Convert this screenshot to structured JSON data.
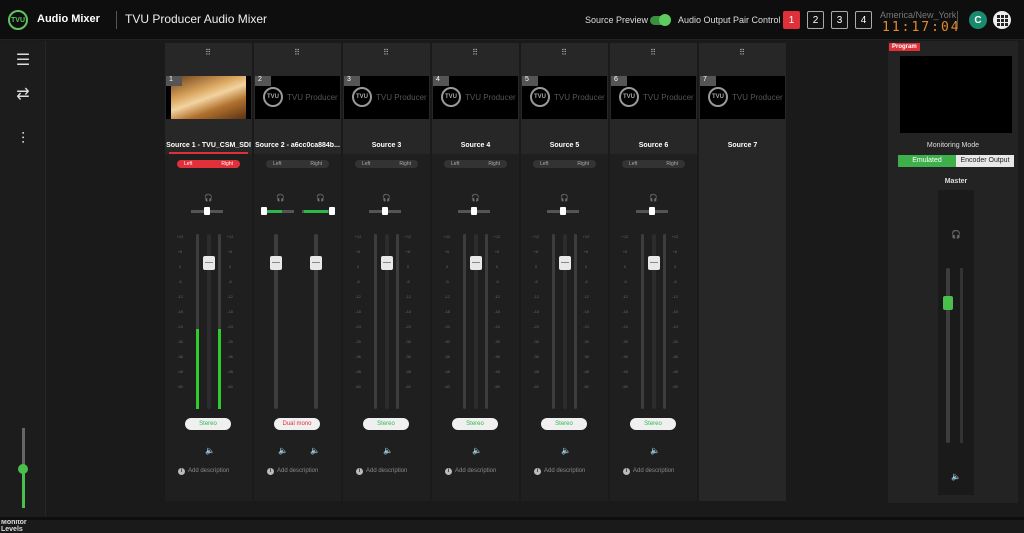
{
  "app": {
    "name": "Audio Mixer",
    "title": "TVU Producer Audio Mixer",
    "logo_text": "TVU"
  },
  "header": {
    "source_preview_label": "Source Preview",
    "source_preview_on": true,
    "audio_output_label": "Audio Output Pair Control",
    "pairs": [
      "1",
      "2",
      "3",
      "4"
    ],
    "active_pair": "1",
    "timezone": "America/New_York",
    "clock": "11:17:04",
    "avatar_initial": "C"
  },
  "left_nav": {
    "monitor_label": "Monitor Levels",
    "monitor_level": 0.5
  },
  "strips": [
    {
      "num": "1",
      "name": "Source 1 - TVU_CSM_SDI",
      "left": "Left",
      "right": "Right",
      "mode": "Stereo",
      "has_video": true,
      "active": true,
      "desc": "Add description"
    },
    {
      "num": "2",
      "name": "Source 2 - a6cc0ca884b...",
      "left": "Left",
      "right": "Right",
      "mode": "Dual mono",
      "has_video": false,
      "active": false,
      "desc": "Add description"
    },
    {
      "num": "3",
      "name": "Source 3",
      "left": "Left",
      "right": "Right",
      "mode": "Stereo",
      "has_video": false,
      "active": false,
      "desc": "Add description"
    },
    {
      "num": "4",
      "name": "Source 4",
      "left": "Left",
      "right": "Right",
      "mode": "Stereo",
      "has_video": false,
      "active": false,
      "desc": "Add description"
    },
    {
      "num": "5",
      "name": "Source 5",
      "left": "Left",
      "right": "Right",
      "mode": "Stereo",
      "has_video": false,
      "active": false,
      "desc": "Add description"
    },
    {
      "num": "6",
      "name": "Source 6",
      "left": "Left",
      "right": "Right",
      "mode": "Stereo",
      "has_video": false,
      "active": false,
      "desc": "Add description"
    },
    {
      "num": "7",
      "name": "Source 7",
      "left": "",
      "right": "",
      "mode": "",
      "has_video": false,
      "active": false,
      "desc": ""
    }
  ],
  "placeholder_brand": "TVU Producer",
  "scale_labels": [
    "+12",
    "+6",
    "0",
    "-6",
    "-12",
    "-18",
    "-24",
    "-30",
    "-36",
    "-48",
    "-60"
  ],
  "right_panel": {
    "program_label": "Program",
    "monitoring_mode_label": "Monitoring Mode",
    "modes": [
      "Emulated",
      "Encoder Output"
    ],
    "active_mode": "Emulated",
    "master_label": "Master"
  },
  "colors": {
    "accent_red": "#e0313b",
    "accent_green": "#3db04b",
    "clock_orange": "#e58a2c"
  }
}
